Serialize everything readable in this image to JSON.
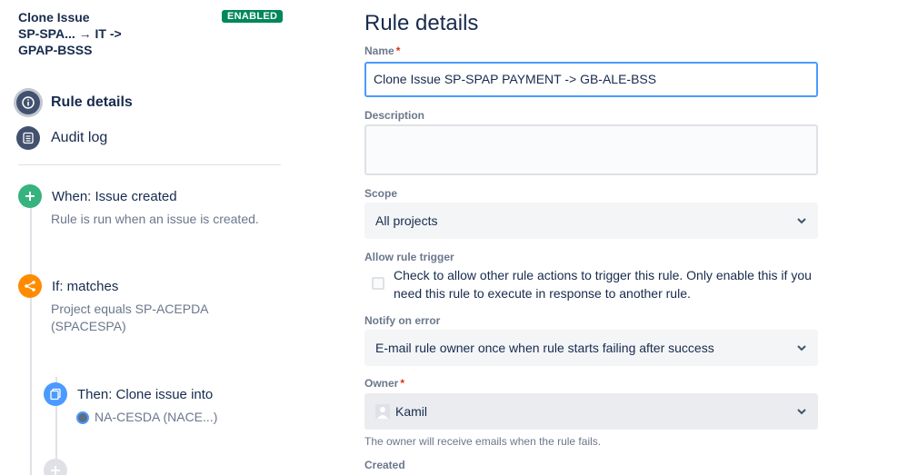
{
  "rule": {
    "title_line1": "Clone Issue",
    "title_line2": "SP-SPA... → IT ->",
    "title_line3": "GPAP-BSSS",
    "status": "ENABLED"
  },
  "nav": {
    "rule_details": "Rule details",
    "audit_log": "Audit log"
  },
  "flow": {
    "trigger_title": "When: Issue created",
    "trigger_desc": "Rule is run when an issue is created.",
    "condition_title": "If: matches",
    "condition_desc_line1": "Project equals SP-ACEPDA",
    "condition_desc_line2": "(SPACESPA)",
    "action_title": "Then: Clone issue into",
    "action_target": "NA-CESDA (NACE...)"
  },
  "form": {
    "page_title": "Rule details",
    "name_label": "Name",
    "name_value": "Clone Issue SP-SPAP PAYMENT -> GB-ALE-BSS",
    "description_label": "Description",
    "description_value": "",
    "scope_label": "Scope",
    "scope_value": "All projects",
    "allow_trigger_label": "Allow rule trigger",
    "allow_trigger_text": "Check to allow other rule actions to trigger this rule. Only enable this if you need this rule to execute in response to another rule.",
    "notify_label": "Notify on error",
    "notify_value": "E-mail rule owner once when rule starts failing after success",
    "owner_label": "Owner",
    "owner_value": "Kamil",
    "owner_helper": "The owner will receive emails when the rule fails.",
    "created_label": "Created",
    "required_mark": "*"
  },
  "colors": {
    "enabled": "#00875a",
    "trigger": "#36b37e",
    "condition": "#ff8b00",
    "action": "#4c9aff",
    "focus": "#4c9aff"
  },
  "icons": {
    "rule_details": "info-icon",
    "audit_log": "list-icon",
    "trigger": "plus-icon",
    "condition": "branch-icon",
    "action": "clone-icon",
    "add": "plus-icon",
    "dropdown": "chevron-down-icon",
    "owner": "user-icon"
  }
}
